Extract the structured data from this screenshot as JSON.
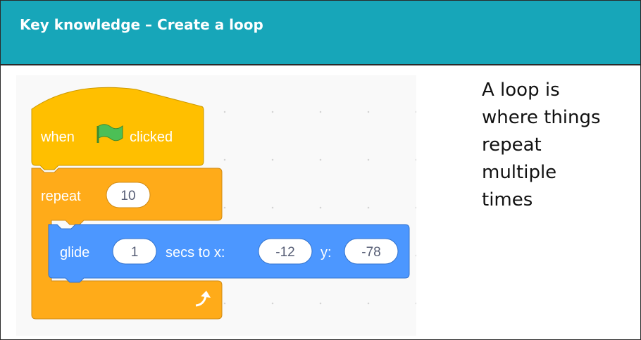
{
  "header": {
    "title": "Key knowledge – Create a loop"
  },
  "description": {
    "lines": [
      "A loop is",
      "where things",
      "repeat",
      "multiple",
      "times"
    ]
  },
  "blocks": {
    "event": {
      "when": "when",
      "icon": "green-flag-icon",
      "clicked": "clicked",
      "color": "#ffbf00"
    },
    "repeat": {
      "label": "repeat",
      "count": "10",
      "color": "#ffab19",
      "loop_icon": "loop-arrow-icon"
    },
    "glide": {
      "label": "glide",
      "secs": "1",
      "to_x": "secs to x:",
      "x": "-12",
      "y_label": "y:",
      "y": "-78",
      "color": "#4c97ff"
    }
  },
  "colors": {
    "header": "#17a6b9",
    "border": "#2a2a2a"
  }
}
